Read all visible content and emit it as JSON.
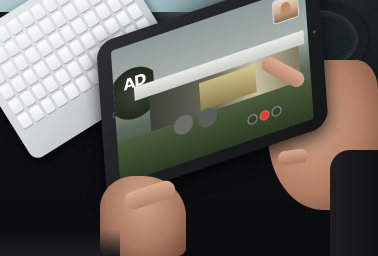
{
  "photo": {
    "subject": "hands-holding-tablet-video-call",
    "screen_logo_text": "AD"
  },
  "colors": {
    "desk": "#0d0e10",
    "keyboard": "#e3e8eb",
    "tablet_body": "#1b1d1f",
    "end_call": "#e43b3b",
    "skin": "#c8977b"
  },
  "icons": {
    "end_call": "end-call-icon",
    "mute": "mute-icon",
    "camera_toggle": "camera-icon"
  }
}
